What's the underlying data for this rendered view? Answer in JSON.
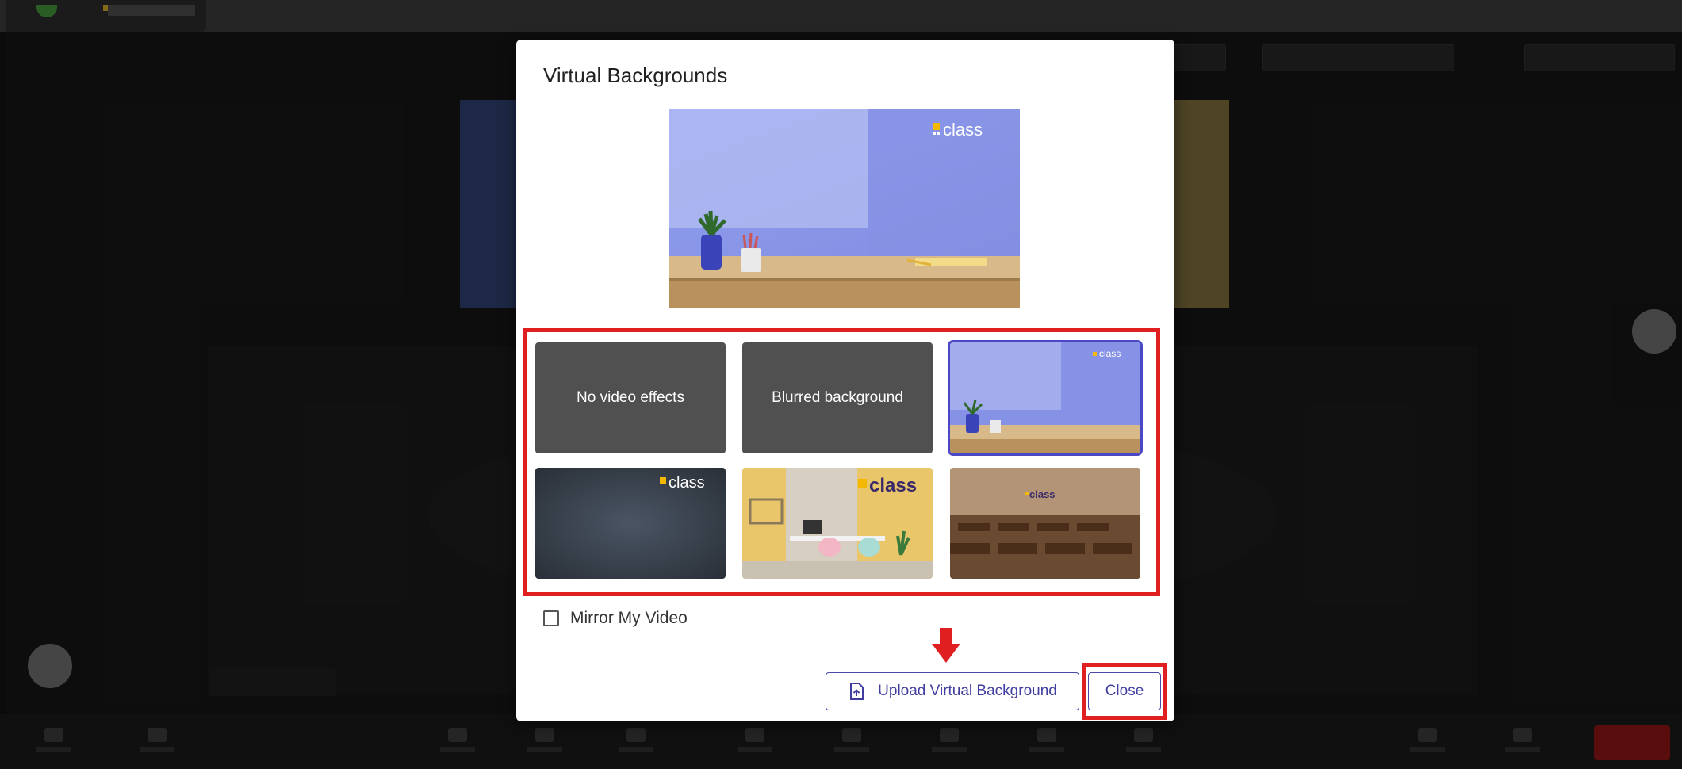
{
  "modal": {
    "title": "Virtual Backgrounds",
    "options": {
      "none_label": "No video effects",
      "blur_label": "Blurred background"
    },
    "logo_text": "class",
    "mirror_label": "Mirror My Video",
    "mirror_checked": false,
    "upload_label": "Upload Virtual Background",
    "close_label": "Close"
  },
  "colors": {
    "accent": "#4a48c6",
    "highlight": "#e02020",
    "tile_bg": "#505050",
    "leave_button": "#8a1414"
  }
}
